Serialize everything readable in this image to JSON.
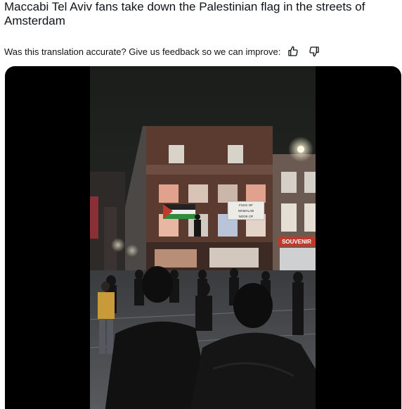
{
  "post": {
    "title": "Maccabi Tel Aviv fans take down the Palestinian flag in the streets of Amsterdam",
    "feedback_question": "Was this translation accurate? Give us feedback so we can improve:",
    "thumbs_up_icon": "thumbs-up-icon",
    "thumbs_down_icon": "thumbs-down-icon"
  },
  "video": {
    "banner_text_1": "FUCK  OF",
    "banner_text_2": "MAMALAB",
    "banner_text_3": "NOOK  OF",
    "shop_sign": "SOUVENIR"
  },
  "colors": {
    "text": "#0f1419",
    "media_bg": "#000000",
    "shop_sign_red": "#c0392b"
  }
}
